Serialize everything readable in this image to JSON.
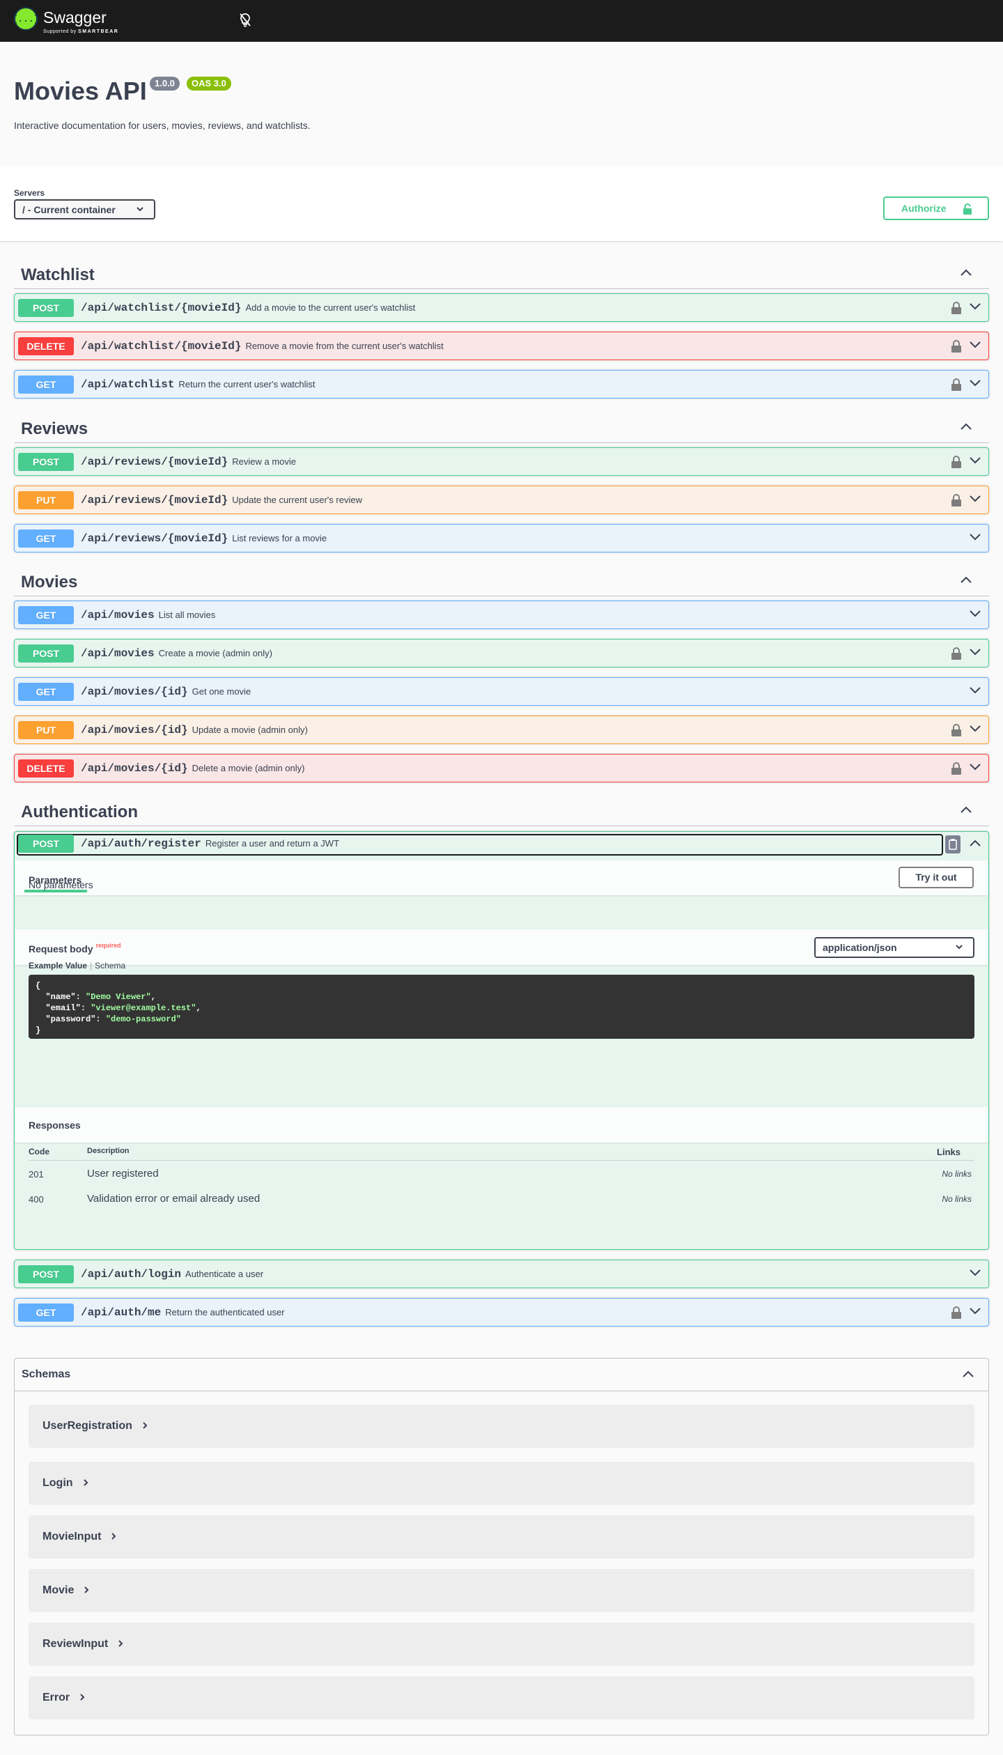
{
  "topbar": {
    "logo_mark": "{...}",
    "logo_text": "Swagger",
    "logo_sub_prefix": "Supported by",
    "logo_sub_brand": "SMARTBEAR"
  },
  "info": {
    "title": "Movies API",
    "version": "1.0.0",
    "oas": "OAS 3.0",
    "description": "Interactive documentation for users, movies, reviews, and watchlists."
  },
  "servers": {
    "label": "Servers",
    "selected": "/ - Current container",
    "authorize_label": "Authorize"
  },
  "colors": {
    "post": "#49cc90",
    "get": "#61affe",
    "put": "#fca130",
    "delete": "#f93e3e",
    "topbar": "#1b1b1b",
    "logo": "#85ea2d"
  },
  "tags": [
    {
      "name": "Watchlist",
      "ops": [
        {
          "method": "POST",
          "path": "/api/watchlist/{movieId}",
          "summary": "Add a movie to the current user's watchlist",
          "locked": true
        },
        {
          "method": "DELETE",
          "path": "/api/watchlist/{movieId}",
          "summary": "Remove a movie from the current user's watchlist",
          "locked": true
        },
        {
          "method": "GET",
          "path": "/api/watchlist",
          "summary": "Return the current user's watchlist",
          "locked": true
        }
      ]
    },
    {
      "name": "Reviews",
      "ops": [
        {
          "method": "POST",
          "path": "/api/reviews/{movieId}",
          "summary": "Review a movie",
          "locked": true
        },
        {
          "method": "PUT",
          "path": "/api/reviews/{movieId}",
          "summary": "Update the current user's review",
          "locked": true
        },
        {
          "method": "GET",
          "path": "/api/reviews/{movieId}",
          "summary": "List reviews for a movie",
          "locked": false
        }
      ]
    },
    {
      "name": "Movies",
      "ops": [
        {
          "method": "GET",
          "path": "/api/movies",
          "summary": "List all movies",
          "locked": false
        },
        {
          "method": "POST",
          "path": "/api/movies",
          "summary": "Create a movie (admin only)",
          "locked": true
        },
        {
          "method": "GET",
          "path": "/api/movies/{id}",
          "summary": "Get one movie",
          "locked": false
        },
        {
          "method": "PUT",
          "path": "/api/movies/{id}",
          "summary": "Update a movie (admin only)",
          "locked": true
        },
        {
          "method": "DELETE",
          "path": "/api/movies/{id}",
          "summary": "Delete a movie (admin only)",
          "locked": true
        }
      ]
    },
    {
      "name": "Authentication",
      "ops": [
        {
          "method": "POST",
          "path": "/api/auth/register",
          "summary": "Register a user and return a JWT",
          "locked": false,
          "expanded": true
        },
        {
          "method": "POST",
          "path": "/api/auth/login",
          "summary": "Authenticate a user",
          "locked": false
        },
        {
          "method": "GET",
          "path": "/api/auth/me",
          "summary": "Return the authenticated user",
          "locked": true
        }
      ]
    }
  ],
  "expanded_op": {
    "parameters_tab": "Parameters",
    "try_it_out": "Try it out",
    "no_parameters": "No parameters",
    "request_body_label": "Request body",
    "required_label": "required",
    "content_type": "application/json",
    "example_value_tab": "Example Value",
    "schema_tab": "Schema",
    "example_json": {
      "open": "{",
      "name_key": "\"name\"",
      "name_val": "\"Demo Viewer\"",
      "email_key": "\"email\"",
      "email_val": "\"viewer@example.test\"",
      "password_key": "\"password\"",
      "password_val": "\"demo-password\"",
      "close": "}"
    },
    "responses_title": "Responses",
    "responses_headers": {
      "code": "Code",
      "description": "Description",
      "links": "Links"
    },
    "responses": [
      {
        "code": "201",
        "description": "User registered",
        "links": "No links"
      },
      {
        "code": "400",
        "description": "Validation error or email already used",
        "links": "No links"
      }
    ]
  },
  "schemas": {
    "title": "Schemas",
    "items": [
      "UserRegistration",
      "Login",
      "MovieInput",
      "Movie",
      "ReviewInput",
      "Error"
    ]
  }
}
